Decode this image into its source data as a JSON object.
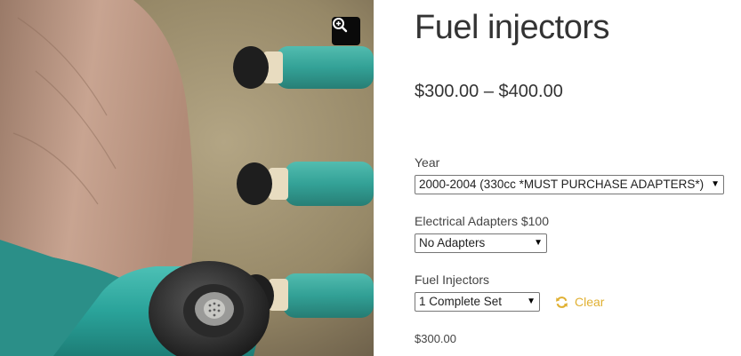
{
  "product": {
    "title": "Fuel injectors",
    "price_range": "$300.00 – $400.00",
    "variation_price": "$300.00"
  },
  "gallery": {
    "zoom_icon": "magnifier-plus-icon"
  },
  "variations": {
    "year": {
      "label": "Year",
      "selected": "2000-2004 (330cc *MUST PURCHASE ADAPTERS*)"
    },
    "adapters": {
      "label": "Electrical Adapters $100",
      "selected": "No Adapters"
    },
    "injectors": {
      "label": "Fuel Injectors",
      "selected": "1 Complete Set"
    },
    "clear_label": "Clear",
    "clear_icon": "refresh-icon"
  },
  "colors": {
    "accent": "#e0b032",
    "text": "#333333",
    "injector_teal": "#2aa39a"
  }
}
